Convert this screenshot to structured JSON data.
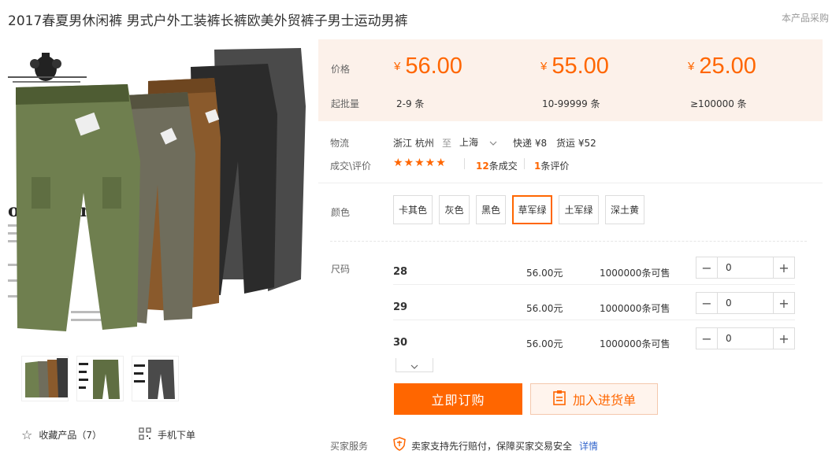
{
  "header": {
    "title": "2017春夏男休闲裤 男式户外工装裤长裤欧美外贸裤子男士运动男裤",
    "note": "本产品采购"
  },
  "gallery": {
    "favorite_label": "收藏产品（7）",
    "mobile_label": "手机下单"
  },
  "pricing": {
    "price_label": "价格",
    "moq_label": "起批量",
    "currency": "¥",
    "tiers": [
      {
        "price": "56.00",
        "range": "2-9 条"
      },
      {
        "price": "55.00",
        "range": "10-99999 条"
      },
      {
        "price": "25.00",
        "range": "≥100000 条"
      }
    ]
  },
  "logistics": {
    "label": "物流",
    "from": "浙江 杭州",
    "to_word": "至",
    "to": "上海",
    "express": "快递 ¥8",
    "freight": "货运 ¥52"
  },
  "reviews": {
    "label": "成交\\评价",
    "stars": "★★★★★",
    "deals_count": "12",
    "deals_text": "条成交",
    "reviews_count": "1",
    "reviews_text": "条评价"
  },
  "colors": {
    "label": "颜色",
    "options": [
      "卡其色",
      "灰色",
      "黑色",
      "草军绿",
      "土军绿",
      "深土黄"
    ],
    "selected": "草军绿"
  },
  "sizes": {
    "label": "尺码",
    "rows": [
      {
        "size": "28",
        "price": "56.00元",
        "stock": "1000000条可售",
        "qty": "0"
      },
      {
        "size": "29",
        "price": "56.00元",
        "stock": "1000000条可售",
        "qty": "0"
      },
      {
        "size": "30",
        "price": "56.00元",
        "stock": "1000000条可售",
        "qty": "0"
      }
    ]
  },
  "actions": {
    "buy_label": "立即订购",
    "cart_label": "加入进货单"
  },
  "service": {
    "label": "买家服务",
    "text": "卖家支持先行赔付，保障买家交易安全",
    "link": "详情"
  },
  "colors_theme": {
    "accent": "#ff6600",
    "panel_bg": "#fcf1ea"
  }
}
